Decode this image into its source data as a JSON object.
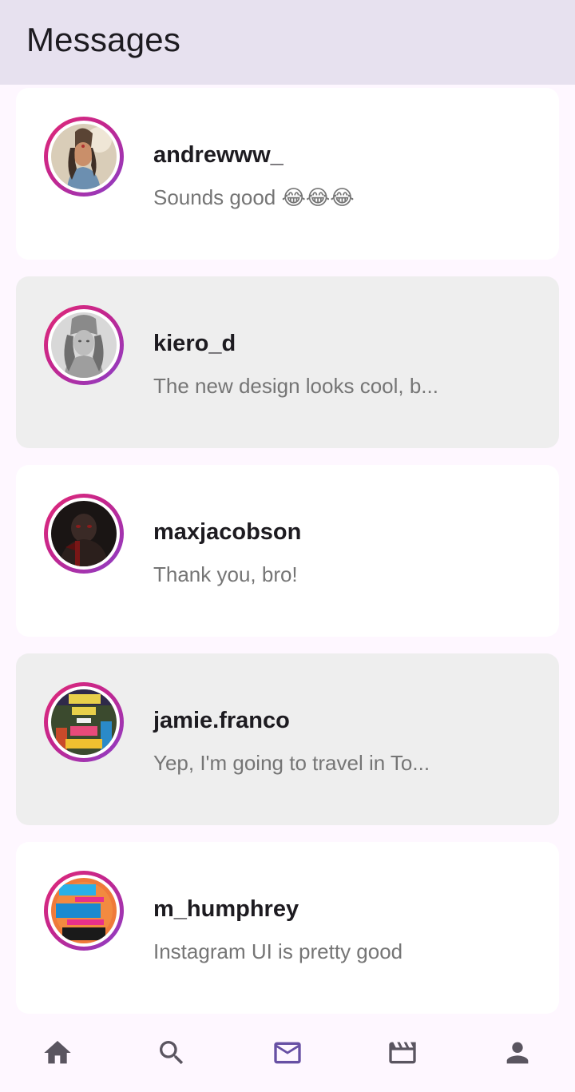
{
  "app_bar": {
    "title": "Messages"
  },
  "conversations": [
    {
      "username": "andrewww_",
      "preview": "Sounds good 😂😂😂",
      "avatar_icon": "avatar-shiva-colored"
    },
    {
      "username": "kiero_d",
      "preview": "The new design looks cool, b...",
      "avatar_icon": "avatar-shiva-grey"
    },
    {
      "username": "maxjacobson",
      "preview": "Thank you, bro!",
      "avatar_icon": "avatar-dark-warrior"
    },
    {
      "username": "jamie.franco",
      "preview": "Yep, I'm going to travel in To...",
      "avatar_icon": "avatar-every-day-poster"
    },
    {
      "username": "m_humphrey",
      "preview": "Instagram UI is pretty good",
      "avatar_icon": "avatar-never-fear-poster"
    }
  ],
  "bottom_nav": {
    "items": [
      {
        "icon": "home-icon",
        "selected": false
      },
      {
        "icon": "search-icon",
        "selected": false
      },
      {
        "icon": "mail-icon",
        "selected": true
      },
      {
        "icon": "movie-icon",
        "selected": false
      },
      {
        "icon": "person-icon",
        "selected": false
      }
    ]
  },
  "colors": {
    "app_bar_bg": "#e7e1ef",
    "page_bg": "#fef7ff",
    "selected_nav": "#6750a4",
    "unselected_nav": "#49454f",
    "ring_start": "#e02a78",
    "ring_end": "#8a3fc9"
  }
}
